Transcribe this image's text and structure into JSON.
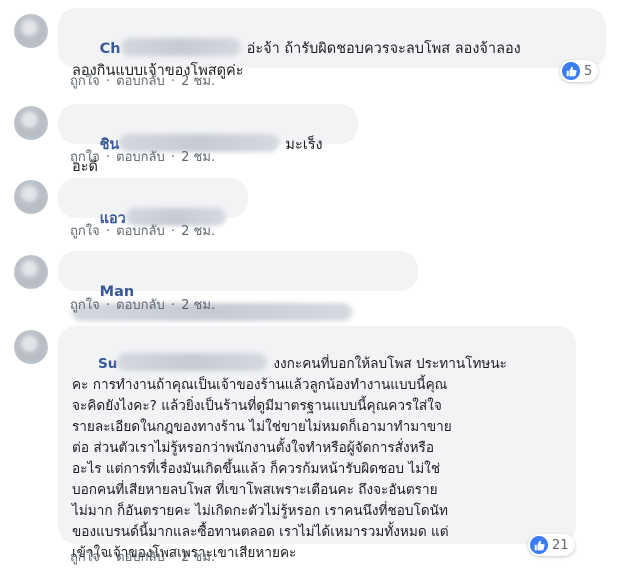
{
  "comments": [
    {
      "author_visible": "Ch",
      "text": "อ่ะจ้า ถ้ารับผิดชอบควรจะลบโพส ลองจ้าลอง\nลองกินแบบเจ้าของโพสดูค่ะ",
      "like_label": "ถูกใจ",
      "reply_label": "ตอบกลับ",
      "sep": "·",
      "time": "2 ชม.",
      "reactions": "5"
    },
    {
      "author_visible": "ชิน",
      "text": "มะเร็งอะดิ",
      "like_label": "ถูกใจ",
      "reply_label": "ตอบกลับ",
      "sep": "·",
      "time": "2 ชม."
    },
    {
      "author_visible": "แอว",
      "text": "",
      "like_label": "ถูกใจ",
      "reply_label": "ตอบกลับ",
      "sep": "·",
      "time": "2 ชม."
    },
    {
      "author_visible": "Man",
      "text": "",
      "like_label": "ถูกใจ",
      "reply_label": "ตอบกลับ",
      "sep": "·",
      "time": "2 ชม."
    },
    {
      "author_visible": "Su",
      "text": "งงกะคนที่บอกให้ลบโพส ประทานโทษนะ\nคะ การทำงานถ้าคุณเป็นเจ้าของร้านแล้วลูกน้องทำงานแบบนี้คุณ\nจะคิดยังไงคะ? แล้วยิ่งเป็นร้านที่ดูมีมาตรฐานแบบนี้คุณควรใส่ใจ\nรายละเอียดในกฎของทางร้าน ไม่ใช่ขายไม่หมดก็เอามาทำมาขาย\nต่อ ส่วนตัวเราไม่รู้หรอกว่าพนักงานตั้งใจทำหรือผู้จัดการสั่งหรือ\nอะไร แต่การที่เรื่องมันเกิดขึ้นแล้ว ก็ควรก้มหน้ารับผิดชอบ ไม่ใช่\nบอกคนที่เสียหายลบโพส ที่เขาโพสเพราะเตือนคะ ถึงจะอันตราย\nไม่มาก ก็อันตรายคะ ไม่เกิดกะตัวไม่รู้หรอก เราคนนึงที่ชอบโดนัท\nของแบรนด์นี้มากและซื้อทานตลอด เราไม่ได้เหมารวมทั้งหมด แต่\nเข้าใจเจ้าของโพสเพราะเขาเสียหายคะ",
      "like_label": "ถูกใจ",
      "reply_label": "ตอบกลับ",
      "sep": "·",
      "time": "2 ชม.",
      "reactions": "21"
    }
  ],
  "colors": {
    "name": "#385898",
    "bubble": "#f2f3f5",
    "link": "#606770",
    "like": "#3b7cf7"
  }
}
